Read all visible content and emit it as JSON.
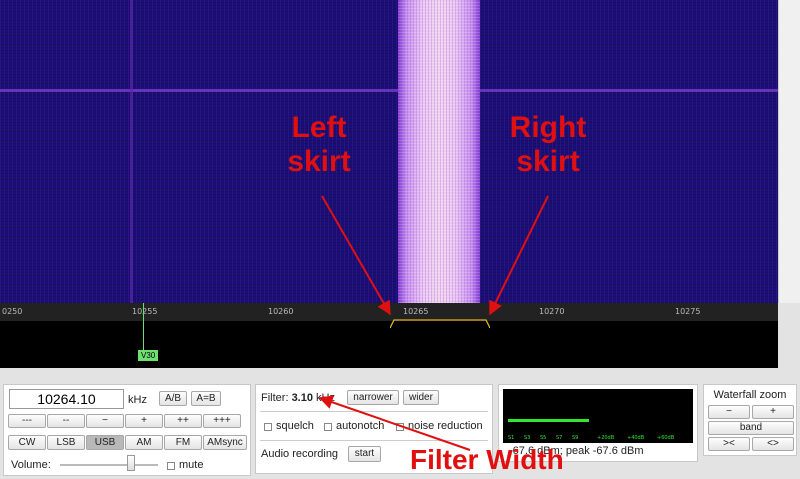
{
  "scale": {
    "ticks": [
      "0250",
      "10255",
      "10260",
      "10265",
      "10270",
      "10275"
    ],
    "marker_label": "V30"
  },
  "annotations": {
    "left": "Left\nskirt",
    "right": "Right\nskirt",
    "filter": "Filter Width"
  },
  "freq_panel": {
    "frequency": "10264.10",
    "unit": "kHz",
    "ab_label": "A/B",
    "aeqb_label": "A=B",
    "step_buttons": [
      "---",
      "--",
      "−",
      "+",
      "++",
      "+++"
    ],
    "mode_buttons": [
      "CW",
      "LSB",
      "USB",
      "AM",
      "FM",
      "AMsync"
    ],
    "active_mode": "USB",
    "volume_label": "Volume:",
    "volume_level": 0.72,
    "mute_label": "mute"
  },
  "filter_panel": {
    "label": "Filter:",
    "value": "3.10",
    "unit": "kHz",
    "narrower_label": "narrower",
    "wider_label": "wider",
    "squelch_label": "squelch",
    "autonotch_label": "autonotch",
    "noise_label": "noise reduction",
    "recording_label": "Audio recording",
    "start_label": "start"
  },
  "smeter_panel": {
    "scale_labels": [
      "S1",
      "S3",
      "S5",
      "S7",
      "S9",
      "+20dB",
      "+40dB",
      "+60dB"
    ],
    "level_fraction": 0.45,
    "readout": "-67.6 dBm; peak  -67.6 dBm"
  },
  "zoom_panel": {
    "title": "Waterfall zoom",
    "minus_label": "−",
    "plus_label": "+",
    "band_label": "band",
    "in_label": "><",
    "out_label": "<>"
  },
  "colors": {
    "annotation": "#e01010",
    "meter_green": "#2ee82e",
    "passband_yellow": "#e0b020"
  }
}
